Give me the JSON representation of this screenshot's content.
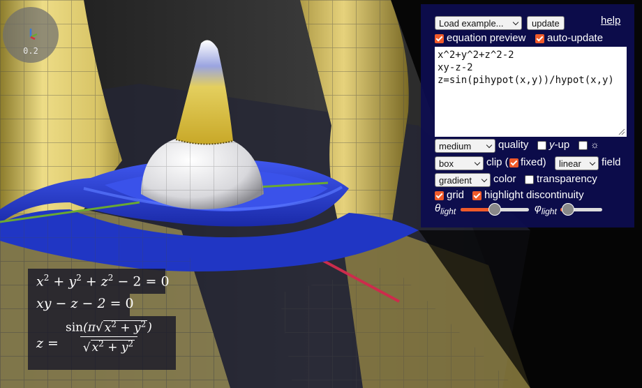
{
  "view": {
    "scale_label": "0.2"
  },
  "equations_preview": [
    "x² + y² + z² − 2 = 0",
    "xy − z − 2 = 0",
    "z = sin(π√(x² + y²)) / √(x² + y²)"
  ],
  "panel": {
    "example_select": "Load example...",
    "update_button": "update",
    "help_link": "help",
    "equation_preview_label": "equation preview",
    "equation_preview_checked": true,
    "auto_update_label": "auto-update",
    "auto_update_checked": true,
    "equation_text": "x^2+y^2+z^2-2\nxy-z-2\nz=sin(pihypot(x,y))/hypot(x,y)",
    "quality_select": "medium",
    "quality_label": "quality",
    "y_up_label": "y",
    "y_up_suffix": "-up",
    "y_up_checked": false,
    "light_toggle_icon": "☼",
    "light_toggle_checked": false,
    "clip_select": "box",
    "clip_label": "clip (",
    "fixed_label": "fixed)",
    "fixed_checked": true,
    "field_select": "linear",
    "field_label": "field",
    "color_select": "gradient",
    "color_label": "color",
    "transparency_label": "transparency",
    "transparency_checked": false,
    "grid_label": "grid",
    "grid_checked": true,
    "highlight_label": "highlight discontinuity",
    "highlight_checked": true,
    "theta_label": "θ",
    "theta_sub": "light",
    "theta_value": 0.5,
    "phi_label": "φ",
    "phi_sub": "light",
    "phi_value": 0.18
  },
  "colors": {
    "panel_bg": "#0d0d50",
    "accent": "#f05a2a",
    "surface_blue": "#2b3fd8",
    "surface_yellow": "#e2cf68"
  }
}
